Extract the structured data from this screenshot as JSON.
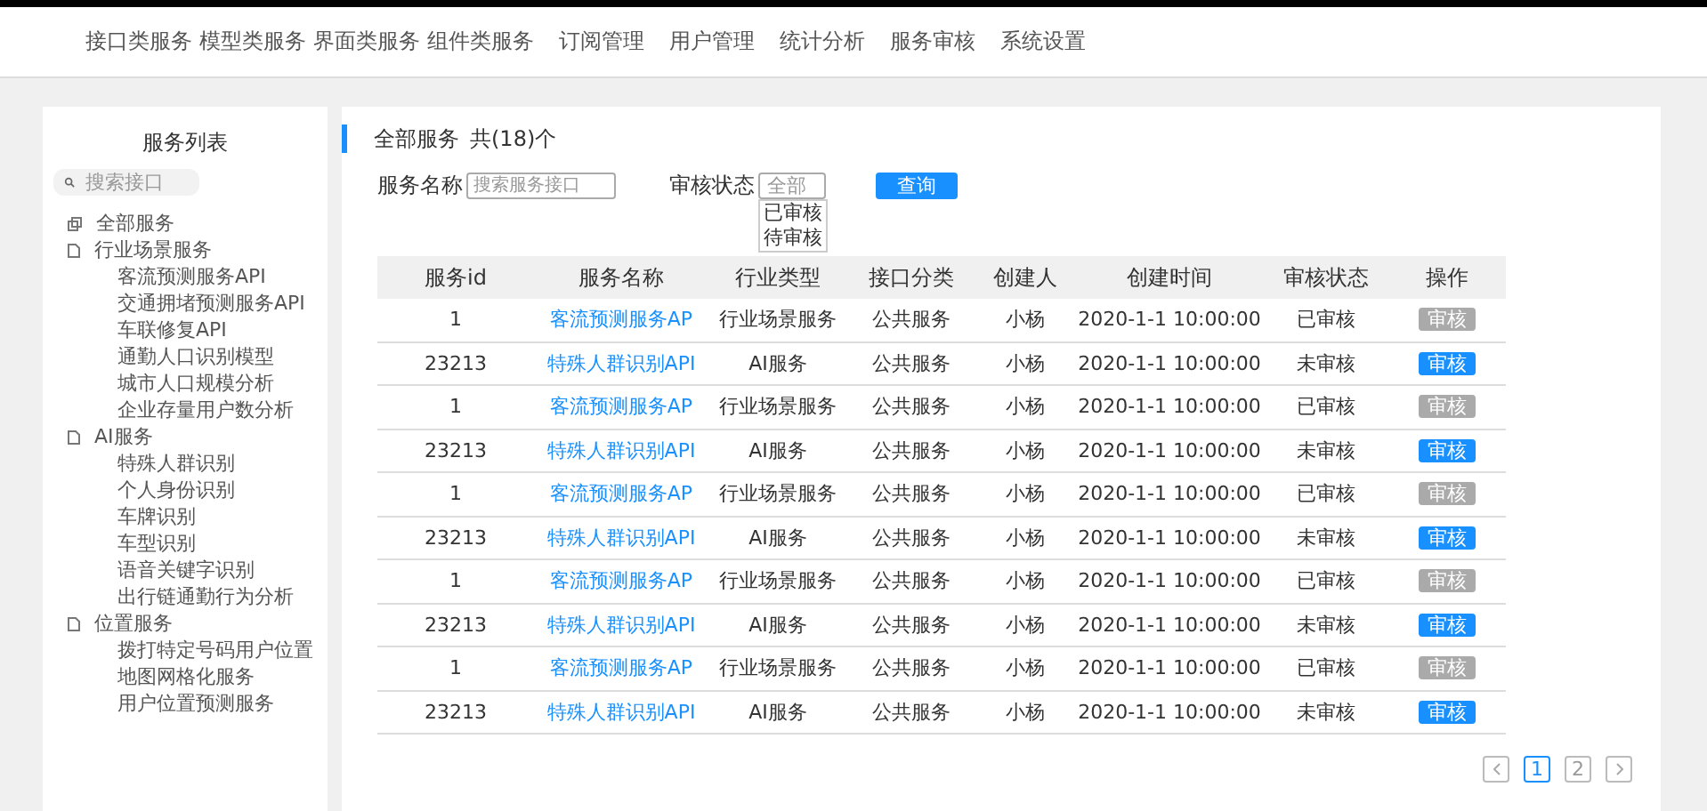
{
  "nav": [
    {
      "label": "接口类服务",
      "selected": false
    },
    {
      "label": "模型类服务",
      "selected": false
    },
    {
      "label": "界面类服务",
      "selected": false
    },
    {
      "label": "组件类服务",
      "selected": false
    },
    {
      "label": "订阅管理",
      "selected": false
    },
    {
      "label": "用户管理",
      "selected": false
    },
    {
      "label": "统计分析",
      "selected": false
    },
    {
      "label": "服务审核",
      "selected": false
    },
    {
      "label": "系统设置",
      "selected": false
    }
  ],
  "sidebar": {
    "title": "服务列表",
    "search": {
      "placeholder": "搜索接口"
    },
    "tree": [
      {
        "label": "全部服务",
        "kind": "all"
      },
      {
        "label": "行业场景服务",
        "kind": "folder",
        "children": [
          {
            "label": "客流预测服务API"
          },
          {
            "label": "交通拥堵预测服务API"
          },
          {
            "label": "车联修复API"
          },
          {
            "label": "通勤人口识别模型"
          },
          {
            "label": "城市人口规模分析"
          },
          {
            "label": "企业存量用户数分析"
          }
        ]
      },
      {
        "label": "AI服务",
        "kind": "folder",
        "children": [
          {
            "label": "特殊人群识别"
          },
          {
            "label": "个人身份识别"
          },
          {
            "label": "车牌识别"
          },
          {
            "label": "车型识别"
          },
          {
            "label": "语音关键字识别"
          },
          {
            "label": "出行链通勤行为分析"
          }
        ]
      },
      {
        "label": "位置服务",
        "kind": "folder",
        "children": [
          {
            "label": "拨打特定号码用户位置"
          },
          {
            "label": "地图网格化服务"
          },
          {
            "label": "用户位置预测服务"
          }
        ]
      }
    ]
  },
  "main": {
    "heading": "全部服务",
    "count": "共(18)个",
    "filters": {
      "name_label": "服务名称",
      "name_placeholder": "搜索服务接口",
      "status_label": "审核状态",
      "status_value": "全部",
      "status_options": [
        "已审核",
        "待审核"
      ],
      "query_button": "查询"
    },
    "columns": [
      "服务id",
      "服务名称",
      "行业类型",
      "接口分类",
      "创建人",
      "创建时间",
      "审核状态",
      "操作"
    ],
    "rows": [
      {
        "id": "1",
        "name": "客流预测服务AP",
        "type": "行业场景服务",
        "category": "公共服务",
        "creator": "小杨",
        "time": "2020-1-1 10:00:00",
        "status": "已审核",
        "action": "审核",
        "action_disabled": true
      },
      {
        "id": "23213",
        "name": "特殊人群识别API",
        "type": "AI服务",
        "category": "公共服务",
        "creator": "小杨",
        "time": "2020-1-1 10:00:00",
        "status": "未审核",
        "action": "审核",
        "action_disabled": false
      },
      {
        "id": "1",
        "name": "客流预测服务AP",
        "type": "行业场景服务",
        "category": "公共服务",
        "creator": "小杨",
        "time": "2020-1-1 10:00:00",
        "status": "已审核",
        "action": "审核",
        "action_disabled": true
      },
      {
        "id": "23213",
        "name": "特殊人群识别API",
        "type": "AI服务",
        "category": "公共服务",
        "creator": "小杨",
        "time": "2020-1-1 10:00:00",
        "status": "未审核",
        "action": "审核",
        "action_disabled": false
      },
      {
        "id": "1",
        "name": "客流预测服务AP",
        "type": "行业场景服务",
        "category": "公共服务",
        "creator": "小杨",
        "time": "2020-1-1 10:00:00",
        "status": "已审核",
        "action": "审核",
        "action_disabled": true
      },
      {
        "id": "23213",
        "name": "特殊人群识别API",
        "type": "AI服务",
        "category": "公共服务",
        "creator": "小杨",
        "time": "2020-1-1 10:00:00",
        "status": "未审核",
        "action": "审核",
        "action_disabled": false
      },
      {
        "id": "1",
        "name": "客流预测服务AP",
        "type": "行业场景服务",
        "category": "公共服务",
        "creator": "小杨",
        "time": "2020-1-1 10:00:00",
        "status": "已审核",
        "action": "审核",
        "action_disabled": true
      },
      {
        "id": "23213",
        "name": "特殊人群识别API",
        "type": "AI服务",
        "category": "公共服务",
        "creator": "小杨",
        "time": "2020-1-1 10:00:00",
        "status": "未审核",
        "action": "审核",
        "action_disabled": false
      },
      {
        "id": "1",
        "name": "客流预测服务AP",
        "type": "行业场景服务",
        "category": "公共服务",
        "creator": "小杨",
        "time": "2020-1-1 10:00:00",
        "status": "已审核",
        "action": "审核",
        "action_disabled": true
      },
      {
        "id": "23213",
        "name": "特殊人群识别API",
        "type": "AI服务",
        "category": "公共服务",
        "creator": "小杨",
        "time": "2020-1-1 10:00:00",
        "status": "未审核",
        "action": "审核",
        "action_disabled": false
      }
    ],
    "pagination": {
      "pages": [
        {
          "label": "1",
          "selected": true
        },
        {
          "label": "2",
          "selected": false
        }
      ]
    }
  }
}
